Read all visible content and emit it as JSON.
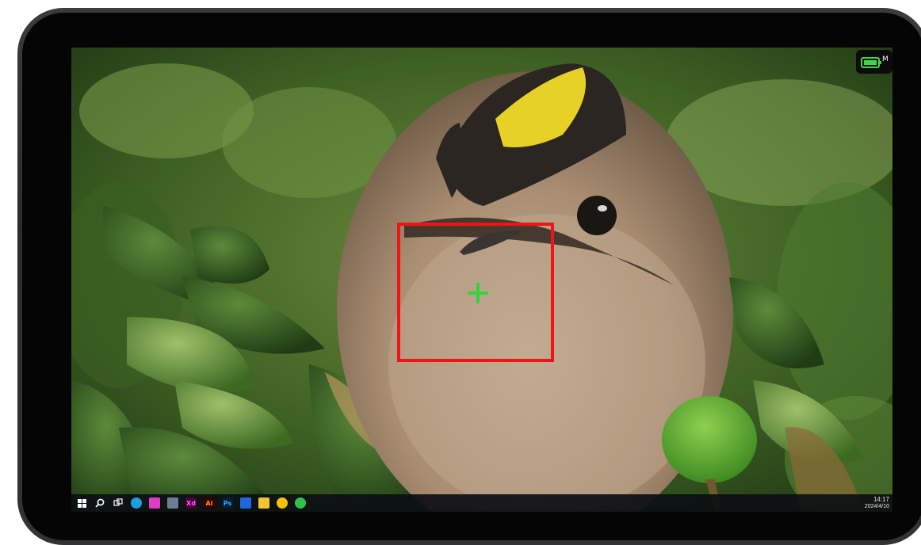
{
  "status": {
    "battery_icon": "battery-icon",
    "battery_badge": "M",
    "battery_color": "#3fd44a"
  },
  "annotation": {
    "box_color": "#f01414",
    "cursor_color": "#33d43b"
  },
  "taskbar": {
    "apps": [
      {
        "name": "windows-start-icon",
        "glyph": "",
        "color": "#ffffff"
      },
      {
        "name": "search-icon",
        "glyph": "",
        "color": "#ffffff"
      },
      {
        "name": "task-view-icon",
        "glyph": "",
        "color": "#ffffff"
      },
      {
        "name": "edge-icon",
        "glyph": "",
        "color": "#1b9de2"
      },
      {
        "name": "photos-icon",
        "glyph": "",
        "color": "#e03cc8"
      },
      {
        "name": "calculator-icon",
        "glyph": "",
        "color": "#6f7d94"
      },
      {
        "name": "adobe-xd-icon",
        "glyph": "Xd",
        "color": "#470137"
      },
      {
        "name": "adobe-illustrator-icon",
        "glyph": "Ai",
        "color": "#330000"
      },
      {
        "name": "adobe-photoshop-icon",
        "glyph": "Ps",
        "color": "#001e36"
      },
      {
        "name": "app-blue-icon",
        "glyph": "",
        "color": "#2266dd"
      },
      {
        "name": "file-explorer-icon",
        "glyph": "",
        "color": "#f2c531"
      },
      {
        "name": "chrome-icon",
        "glyph": "",
        "color": "#f4c20d"
      },
      {
        "name": "wechat-icon",
        "glyph": "",
        "color": "#2fc24a"
      }
    ],
    "time": "14:17",
    "date": "2024/4/10"
  }
}
